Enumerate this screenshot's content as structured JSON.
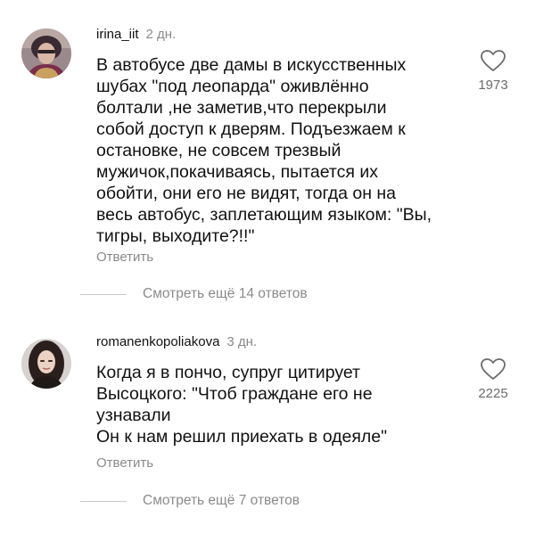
{
  "comments": [
    {
      "username": "irina_iit",
      "time": "2 дн.",
      "text": "В автобусе две дамы в искусственных\nшубах \"под леопарда\" оживлённо\nболтали ,не заметив,что перекрыли\nсобой доступ к дверям. Подъезжаем к\nостановке, не совсем трезвый\nмужичок,покачиваясь, пытается их\nобойти, они его не видят, тогда он на\nвесь автобус, заплетающим языком: \"Вы,\nтигры, выходите?!!\"",
      "reply_label": "Ответить",
      "likes": "1973",
      "more_replies": "Смотреть ещё 14 ответов"
    },
    {
      "username": "romanenkopoliakova",
      "time": "3 дн.",
      "text": "Когда я в пончо, супруг цитирует\nВысоцкого: \"Чтоб граждане его не\nузнавали\nОн к нам решил приехать в одеяле\"",
      "reply_label": "Ответить",
      "likes": "2225",
      "more_replies": "Смотреть ещё 7 ответов"
    }
  ]
}
